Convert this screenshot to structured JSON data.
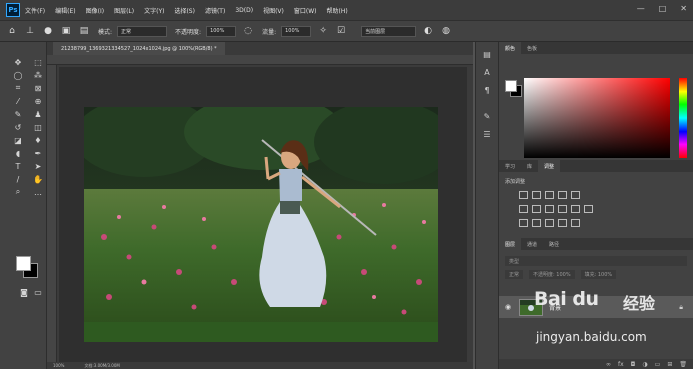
{
  "app": {
    "logo": "Ps"
  },
  "menu": [
    "文件(F)",
    "编辑(E)",
    "图像(I)",
    "图层(L)",
    "文字(Y)",
    "选择(S)",
    "滤镜(T)",
    "3D(D)",
    "视图(V)",
    "窗口(W)",
    "帮助(H)"
  ],
  "window_controls": [
    "—",
    "□",
    "✕"
  ],
  "options": {
    "blend_mode": "正常",
    "opacity_label": "不透明度:",
    "opacity_value": "100%",
    "flow_label": "流量:",
    "flow_value": "100%",
    "sample_value": "当前图层"
  },
  "document": {
    "tab_title": "21238799_1369321334527_1024x1024.jpg @ 100%(RGB/8) *",
    "zoom": "100%",
    "doc_size": "文档:3.00M/3.00M"
  },
  "panels": {
    "color_tabs": [
      "颜色",
      "色板"
    ],
    "adjust_tabs": [
      "学习",
      "库",
      "调整"
    ],
    "adjust_title": "添加调整",
    "layers_tabs": [
      "图层",
      "通道",
      "路径"
    ],
    "layers_kind": "类型",
    "layers_blend": "正常",
    "layers_opacity": "不透明度: 100%",
    "layers_fill": "填充: 100%",
    "layer_name": "背景"
  },
  "watermark": {
    "logo": "Bai du",
    "cn": "经验",
    "url": "jingyan.baidu.com"
  },
  "colors": {
    "app_bg": "#535353",
    "panel": "#424242",
    "accent": "#31a8ff"
  }
}
